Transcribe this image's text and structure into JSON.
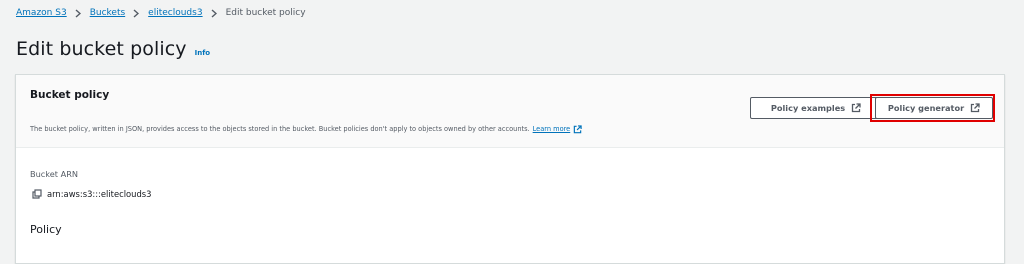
{
  "breadcrumb": {
    "items": [
      {
        "label": "Amazon S3"
      },
      {
        "label": "Buckets"
      },
      {
        "label": "eliteclouds3"
      }
    ],
    "current": "Edit bucket policy"
  },
  "page": {
    "title": "Edit bucket policy",
    "info_label": "Info"
  },
  "panel": {
    "title": "Bucket policy",
    "description": "The bucket policy, written in JSON, provides access to the objects stored in the bucket. Bucket policies don't apply to objects owned by other accounts.",
    "learn_more": "Learn more",
    "buttons": {
      "examples": "Policy examples",
      "generator": "Policy generator"
    }
  },
  "arn": {
    "label": "Bucket ARN",
    "value": "arn:aws:s3:::eliteclouds3"
  },
  "policy": {
    "heading": "Policy"
  },
  "colors": {
    "link": "#0073bb",
    "highlight": "#e00000",
    "background": "#f2f3f3"
  },
  "icons": {
    "separator": "chevron-right-icon",
    "external": "external-link-icon",
    "copy": "copy-icon"
  }
}
